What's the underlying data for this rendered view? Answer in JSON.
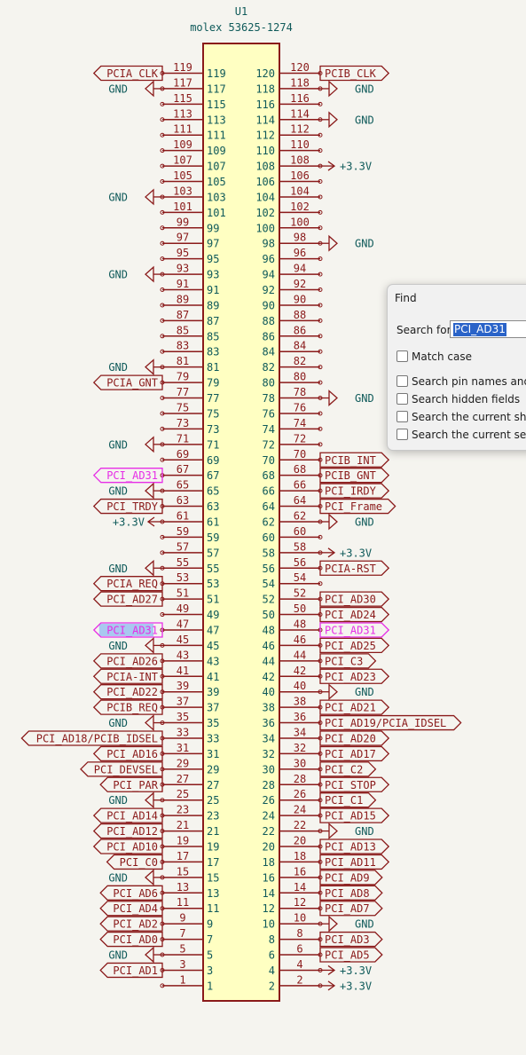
{
  "component": {
    "ref": "U1",
    "value": "molex 53625-1274"
  },
  "pins": [
    {
      "num": "119",
      "net": "PCIA_CLK",
      "kind": "label"
    },
    {
      "num": "117",
      "net": "GND",
      "kind": "gnd"
    },
    {
      "num": "115",
      "net": "",
      "kind": "nc"
    },
    {
      "num": "113",
      "net": "",
      "kind": "nc"
    },
    {
      "num": "111",
      "net": "",
      "kind": "nc"
    },
    {
      "num": "109",
      "net": "",
      "kind": "nc"
    },
    {
      "num": "107",
      "net": "",
      "kind": "nc"
    },
    {
      "num": "105",
      "net": "",
      "kind": "nc"
    },
    {
      "num": "103",
      "net": "GND",
      "kind": "gnd"
    },
    {
      "num": "101",
      "net": "",
      "kind": "nc"
    },
    {
      "num": "99",
      "net": "",
      "kind": "nc"
    },
    {
      "num": "97",
      "net": "",
      "kind": "nc"
    },
    {
      "num": "95",
      "net": "",
      "kind": "nc"
    },
    {
      "num": "93",
      "net": "GND",
      "kind": "gnd"
    },
    {
      "num": "91",
      "net": "",
      "kind": "nc"
    },
    {
      "num": "89",
      "net": "",
      "kind": "nc"
    },
    {
      "num": "87",
      "net": "",
      "kind": "nc"
    },
    {
      "num": "85",
      "net": "",
      "kind": "nc"
    },
    {
      "num": "83",
      "net": "",
      "kind": "nc"
    },
    {
      "num": "81",
      "net": "GND",
      "kind": "gnd"
    },
    {
      "num": "79",
      "net": "PCIA_GNT",
      "kind": "label"
    },
    {
      "num": "77",
      "net": "",
      "kind": "nc"
    },
    {
      "num": "75",
      "net": "",
      "kind": "nc"
    },
    {
      "num": "73",
      "net": "",
      "kind": "nc"
    },
    {
      "num": "71",
      "net": "GND",
      "kind": "gnd"
    },
    {
      "num": "69",
      "net": "",
      "kind": "nc"
    },
    {
      "num": "67",
      "net": "PCI_AD31",
      "kind": "hl"
    },
    {
      "num": "65",
      "net": "GND",
      "kind": "gnd"
    },
    {
      "num": "63",
      "net": "PCI_TRDY",
      "kind": "label"
    },
    {
      "num": "61",
      "net": "+3.3V",
      "kind": "pwr"
    },
    {
      "num": "59",
      "net": "",
      "kind": "nc"
    },
    {
      "num": "57",
      "net": "",
      "kind": "nc"
    },
    {
      "num": "55",
      "net": "GND",
      "kind": "gnd"
    },
    {
      "num": "53",
      "net": "PCIA_REQ",
      "kind": "label"
    },
    {
      "num": "51",
      "net": "PCI_AD27",
      "kind": "label"
    },
    {
      "num": "49",
      "net": "",
      "kind": "nc"
    },
    {
      "num": "47",
      "net": "PCI_AD31",
      "kind": "hlsel"
    },
    {
      "num": "45",
      "net": "GND",
      "kind": "gnd"
    },
    {
      "num": "43",
      "net": "PCI_AD26",
      "kind": "label"
    },
    {
      "num": "41",
      "net": "PCIA-INT",
      "kind": "label"
    },
    {
      "num": "39",
      "net": "PCI_AD22",
      "kind": "label"
    },
    {
      "num": "37",
      "net": "PCIB_REQ",
      "kind": "label"
    },
    {
      "num": "35",
      "net": "GND",
      "kind": "gnd"
    },
    {
      "num": "33",
      "net": "PCI_AD18/PCIB_IDSEL",
      "kind": "label"
    },
    {
      "num": "31",
      "net": "PCI_AD16",
      "kind": "label"
    },
    {
      "num": "29",
      "net": "PCI_DEVSEL",
      "kind": "label"
    },
    {
      "num": "27",
      "net": "PCI_PAR",
      "kind": "label"
    },
    {
      "num": "25",
      "net": "GND",
      "kind": "gnd"
    },
    {
      "num": "23",
      "net": "PCI_AD14",
      "kind": "label"
    },
    {
      "num": "21",
      "net": "PCI_AD12",
      "kind": "label"
    },
    {
      "num": "19",
      "net": "PCI_AD10",
      "kind": "label"
    },
    {
      "num": "17",
      "net": "PCI_C0",
      "kind": "label"
    },
    {
      "num": "15",
      "net": "GND",
      "kind": "gnd"
    },
    {
      "num": "13",
      "net": "PCI_AD6",
      "kind": "label"
    },
    {
      "num": "11",
      "net": "PCI_AD4",
      "kind": "label"
    },
    {
      "num": "9",
      "net": "PCI_AD2",
      "kind": "label"
    },
    {
      "num": "7",
      "net": "PCI_AD0",
      "kind": "label"
    },
    {
      "num": "5",
      "net": "GND",
      "kind": "gnd"
    },
    {
      "num": "3",
      "net": "PCI_AD1",
      "kind": "label"
    },
    {
      "num": "1",
      "net": "",
      "kind": "nc"
    },
    {
      "num": "120",
      "net": "PCIB_CLK",
      "kind": "label"
    },
    {
      "num": "118",
      "net": "GND",
      "kind": "gnd"
    },
    {
      "num": "116",
      "net": "",
      "kind": "nc"
    },
    {
      "num": "114",
      "net": "GND",
      "kind": "gnd"
    },
    {
      "num": "112",
      "net": "",
      "kind": "nc"
    },
    {
      "num": "110",
      "net": "",
      "kind": "nc"
    },
    {
      "num": "108",
      "net": "+3.3V",
      "kind": "pwr"
    },
    {
      "num": "106",
      "net": "",
      "kind": "nc"
    },
    {
      "num": "104",
      "net": "",
      "kind": "nc"
    },
    {
      "num": "102",
      "net": "",
      "kind": "nc"
    },
    {
      "num": "100",
      "net": "",
      "kind": "nc"
    },
    {
      "num": "98",
      "net": "GND",
      "kind": "gnd"
    },
    {
      "num": "96",
      "net": "",
      "kind": "nc"
    },
    {
      "num": "94",
      "net": "",
      "kind": "nc"
    },
    {
      "num": "92",
      "net": "",
      "kind": "nc"
    },
    {
      "num": "90",
      "net": "",
      "kind": "nc"
    },
    {
      "num": "88",
      "net": "",
      "kind": "nc"
    },
    {
      "num": "86",
      "net": "",
      "kind": "nc"
    },
    {
      "num": "84",
      "net": "",
      "kind": "nc"
    },
    {
      "num": "82",
      "net": "",
      "kind": "nc"
    },
    {
      "num": "80",
      "net": "",
      "kind": "nc"
    },
    {
      "num": "78",
      "net": "GND",
      "kind": "gnd"
    },
    {
      "num": "76",
      "net": "",
      "kind": "nc"
    },
    {
      "num": "74",
      "net": "",
      "kind": "nc"
    },
    {
      "num": "72",
      "net": "",
      "kind": "nc"
    },
    {
      "num": "70",
      "net": "PCIB_INT",
      "kind": "label"
    },
    {
      "num": "68",
      "net": "PCIB_GNT",
      "kind": "label"
    },
    {
      "num": "66",
      "net": "PCI_IRDY",
      "kind": "label"
    },
    {
      "num": "64",
      "net": "PCI_Frame",
      "kind": "label"
    },
    {
      "num": "62",
      "net": "GND",
      "kind": "gnd"
    },
    {
      "num": "60",
      "net": "",
      "kind": "nc"
    },
    {
      "num": "58",
      "net": "+3.3V",
      "kind": "pwr"
    },
    {
      "num": "56",
      "net": "PCIA-RST",
      "kind": "label"
    },
    {
      "num": "54",
      "net": "",
      "kind": "nc"
    },
    {
      "num": "52",
      "net": "PCI_AD30",
      "kind": "label"
    },
    {
      "num": "50",
      "net": "PCI_AD24",
      "kind": "label"
    },
    {
      "num": "48",
      "net": "PCI_AD31",
      "kind": "hl"
    },
    {
      "num": "46",
      "net": "PCI_AD25",
      "kind": "label"
    },
    {
      "num": "44",
      "net": "PCI_C3",
      "kind": "label"
    },
    {
      "num": "42",
      "net": "PCI_AD23",
      "kind": "label"
    },
    {
      "num": "40",
      "net": "GND",
      "kind": "gnd"
    },
    {
      "num": "38",
      "net": "PCI_AD21",
      "kind": "label"
    },
    {
      "num": "36",
      "net": "PCI_AD19/PCIA_IDSEL",
      "kind": "label"
    },
    {
      "num": "34",
      "net": "PCI_AD20",
      "kind": "label"
    },
    {
      "num": "32",
      "net": "PCI_AD17",
      "kind": "label"
    },
    {
      "num": "30",
      "net": "PCI_C2",
      "kind": "label"
    },
    {
      "num": "28",
      "net": "PCI_STOP",
      "kind": "label"
    },
    {
      "num": "26",
      "net": "PCI_C1",
      "kind": "label"
    },
    {
      "num": "24",
      "net": "PCI_AD15",
      "kind": "label"
    },
    {
      "num": "22",
      "net": "GND",
      "kind": "gnd"
    },
    {
      "num": "20",
      "net": "PCI_AD13",
      "kind": "label"
    },
    {
      "num": "18",
      "net": "PCI_AD11",
      "kind": "label"
    },
    {
      "num": "16",
      "net": "PCI_AD9",
      "kind": "label"
    },
    {
      "num": "14",
      "net": "PCI_AD8",
      "kind": "label"
    },
    {
      "num": "12",
      "net": "PCI_AD7",
      "kind": "label"
    },
    {
      "num": "10",
      "net": "GND",
      "kind": "gnd"
    },
    {
      "num": "8",
      "net": "PCI_AD3",
      "kind": "label"
    },
    {
      "num": "6",
      "net": "PCI_AD5",
      "kind": "label"
    },
    {
      "num": "4",
      "net": "+3.3V",
      "kind": "pwr"
    },
    {
      "num": "2",
      "net": "+3.3V",
      "kind": "pwr"
    }
  ],
  "colors": {
    "pin": "#8a1a1a",
    "number": "#0f5a5a",
    "body_fill": "#ffffc2",
    "highlight": "#e62ee6",
    "selection": "#a9c8f0",
    "background": "#f5f4ef"
  },
  "find_dialog": {
    "title": "Find",
    "search_label": "Search for:",
    "search_value": "PCI_AD31",
    "options": [
      {
        "label": "Match case",
        "checked": false
      },
      {
        "label": "Search pin names and nu",
        "checked": false
      },
      {
        "label": "Search hidden fields",
        "checked": false
      },
      {
        "label": "Search the current sheet",
        "checked": false
      },
      {
        "label": "Search the current selecti",
        "checked": false
      }
    ]
  }
}
